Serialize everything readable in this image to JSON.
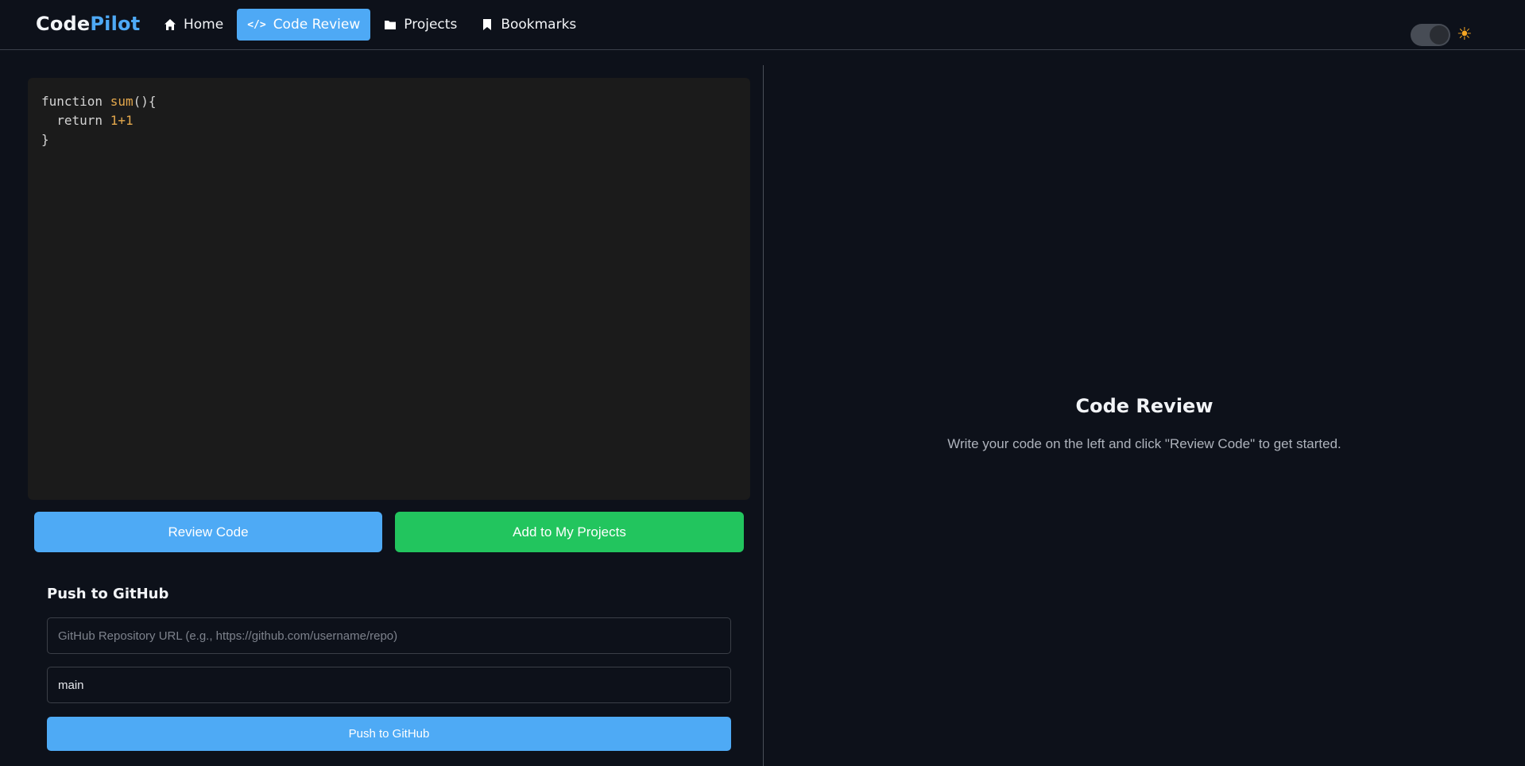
{
  "brand": {
    "part1": "Code",
    "part2": "Pilot"
  },
  "nav": [
    {
      "label": "Home",
      "icon": "home-icon",
      "active": false
    },
    {
      "label": "Code Review",
      "icon": "code-icon",
      "active": true
    },
    {
      "label": "Projects",
      "icon": "folder-icon",
      "active": false
    },
    {
      "label": "Bookmarks",
      "icon": "bookmark-icon",
      "active": false
    }
  ],
  "theme": {
    "icon": "sun-icon",
    "toggle_icon": "theme-toggle"
  },
  "editor": {
    "lines": [
      {
        "parts": [
          {
            "t": "function ",
            "c": "plain"
          },
          {
            "t": "sum",
            "c": "fn"
          },
          {
            "t": "(){",
            "c": "plain"
          }
        ]
      },
      {
        "parts": [
          {
            "t": "  return ",
            "c": "plain"
          },
          {
            "t": "1+1",
            "c": "num"
          }
        ]
      },
      {
        "parts": [
          {
            "t": "}",
            "c": "plain"
          }
        ]
      }
    ]
  },
  "actions": {
    "review_label": "Review Code",
    "add_label": "Add to My Projects"
  },
  "github": {
    "title": "Push to GitHub",
    "url_placeholder": "GitHub Repository URL (e.g., https://github.com/username/repo)",
    "url_value": "",
    "branch_value": "main",
    "push_label": "Push to GitHub"
  },
  "review": {
    "title": "Code Review",
    "subtitle": "Write your code on the left and click \"Review Code\" to get started."
  },
  "colors": {
    "accent": "#4ea9f5",
    "success": "#22c55e",
    "background": "#0d111a",
    "editor_bg": "#1b1b1b"
  }
}
